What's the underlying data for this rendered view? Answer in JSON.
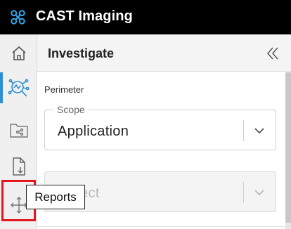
{
  "app": {
    "title": "CAST Imaging"
  },
  "nav": {
    "items": [
      {
        "key": "home",
        "icon": "home-icon",
        "active": false
      },
      {
        "key": "investigate",
        "icon": "investigate-icon",
        "active": true
      },
      {
        "key": "folder-share",
        "icon": "folder-share-icon",
        "active": false
      },
      {
        "key": "reports",
        "icon": "file-download-icon",
        "active": false,
        "highlighted": true
      },
      {
        "key": "move",
        "icon": "move-arrows-icon",
        "active": false
      }
    ],
    "tooltip": "Reports"
  },
  "panel": {
    "title": "Investigate",
    "section_label": "Perimeter",
    "scope": {
      "legend": "Scope",
      "value": "Application"
    },
    "object": {
      "value": "Object",
      "disabled": true
    }
  },
  "colors": {
    "topbar": "#000000",
    "accent": "#2e8fd6",
    "highlight": "#e2171f"
  }
}
